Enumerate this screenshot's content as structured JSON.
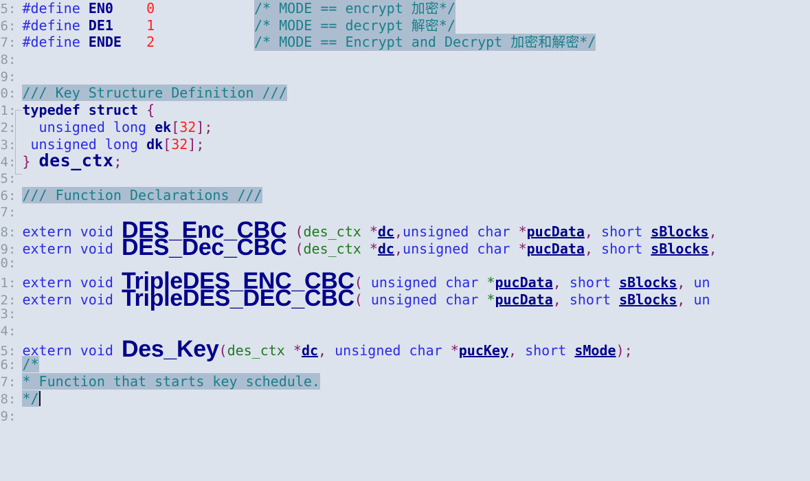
{
  "editor": {
    "background_color": "#dce3ec",
    "comment_highlight_color": "#adbdd0",
    "gutter_color": "#909aa4",
    "keyword_color": "#2a2ae6",
    "identifier_color": "#00008b",
    "number_color": "#ff2020",
    "punctuation_color": "#8b1a6b",
    "comment_color": "#17808a",
    "type_color": "#1f7a1f"
  },
  "lines": [
    {
      "num": "5",
      "tokens": [
        {
          "t": "#define ",
          "c": "kw"
        },
        {
          "t": "EN0",
          "c": "macroname"
        },
        {
          "t": "    ",
          "c": "plain"
        },
        {
          "t": "0",
          "c": "num"
        }
      ],
      "comment": "/* MODE == encrypt 加密*/"
    },
    {
      "num": "6",
      "tokens": [
        {
          "t": "#define ",
          "c": "kw"
        },
        {
          "t": "DE1",
          "c": "macroname"
        },
        {
          "t": "    ",
          "c": "plain"
        },
        {
          "t": "1",
          "c": "num"
        }
      ],
      "comment": "/* MODE == decrypt 解密*/"
    },
    {
      "num": "7",
      "tokens": [
        {
          "t": "#define ",
          "c": "kw"
        },
        {
          "t": "ENDE",
          "c": "macroname"
        },
        {
          "t": "   ",
          "c": "plain"
        },
        {
          "t": "2",
          "c": "num"
        }
      ],
      "comment": "/* MODE == Encrypt and Decrypt 加密和解密*/"
    },
    {
      "num": "8",
      "tokens": [],
      "comment": ""
    },
    {
      "num": "9",
      "tokens": [],
      "comment": ""
    },
    {
      "num": "0",
      "tokens": [],
      "comment_inline": "/// Key Structure Definition  ///"
    },
    {
      "num": "1",
      "tokens": [
        {
          "t": "typedef struct ",
          "c": "kw-b"
        },
        {
          "t": "{",
          "c": "punc"
        }
      ],
      "comment": ""
    },
    {
      "num": "2",
      "tokens": [
        {
          "t": "  unsigned long ",
          "c": "kw"
        },
        {
          "t": "ek",
          "c": "kw-b"
        },
        {
          "t": "[",
          "c": "punc"
        },
        {
          "t": "32",
          "c": "num"
        },
        {
          "t": "]",
          "c": "punc"
        },
        {
          "t": ";",
          "c": "punc"
        }
      ],
      "comment": ""
    },
    {
      "num": "3",
      "tokens": [
        {
          "t": " unsigned long ",
          "c": "kw"
        },
        {
          "t": "dk",
          "c": "kw-b"
        },
        {
          "t": "[",
          "c": "punc"
        },
        {
          "t": "32",
          "c": "num"
        },
        {
          "t": "]",
          "c": "punc"
        },
        {
          "t": ";",
          "c": "punc"
        }
      ],
      "comment": ""
    },
    {
      "num": "4",
      "tokens": [
        {
          "t": "}",
          "c": "punc"
        },
        {
          "t": " ",
          "c": "plain"
        },
        {
          "t": "des_ctx",
          "c": "struct-nm"
        },
        {
          "t": ";",
          "c": "punc"
        }
      ],
      "comment": ""
    },
    {
      "num": "5",
      "tokens": [],
      "comment": ""
    },
    {
      "num": "6",
      "tokens": [],
      "comment_inline": "/// Function Declarations  ///"
    },
    {
      "num": "7",
      "tokens": [],
      "comment": ""
    },
    {
      "num": "8",
      "fn": {
        "prefix": "extern void ",
        "name": "DES_Enc_CBC",
        "args": [
          {
            "t": " (",
            "c": "punc"
          },
          {
            "t": "des_ctx ",
            "c": "type-g"
          },
          {
            "t": "*",
            "c": "punc"
          },
          {
            "t": "dc",
            "c": "param"
          },
          {
            "t": ",",
            "c": "punc"
          },
          {
            "t": "unsigned char ",
            "c": "kw"
          },
          {
            "t": "*",
            "c": "punc"
          },
          {
            "t": "pucData",
            "c": "param"
          },
          {
            "t": ", ",
            "c": "punc"
          },
          {
            "t": "short ",
            "c": "kw"
          },
          {
            "t": "sBlocks",
            "c": "param"
          },
          {
            "t": ",",
            "c": "punc"
          }
        ]
      },
      "comment": ""
    },
    {
      "num": "9",
      "fn": {
        "prefix": "extern void ",
        "name": "DES_Dec_CBC",
        "args": [
          {
            "t": " (",
            "c": "punc"
          },
          {
            "t": "des_ctx ",
            "c": "type-g"
          },
          {
            "t": "*",
            "c": "punc"
          },
          {
            "t": "dc",
            "c": "param"
          },
          {
            "t": ",",
            "c": "punc"
          },
          {
            "t": "unsigned char ",
            "c": "kw"
          },
          {
            "t": "*",
            "c": "punc"
          },
          {
            "t": "pucData",
            "c": "param"
          },
          {
            "t": ", ",
            "c": "punc"
          },
          {
            "t": "short ",
            "c": "kw"
          },
          {
            "t": "sBlocks",
            "c": "param"
          },
          {
            "t": ",",
            "c": "punc"
          }
        ]
      },
      "comment": ""
    },
    {
      "num": "0",
      "tokens": [],
      "comment": ""
    },
    {
      "num": "1",
      "fn": {
        "prefix": "extern void ",
        "name": "TripleDES_ENC_CBC",
        "args": [
          {
            "t": "(",
            "c": "punc"
          },
          {
            "t": " unsigned char ",
            "c": "kw"
          },
          {
            "t": "*",
            "c": "type-g"
          },
          {
            "t": "pucData",
            "c": "param"
          },
          {
            "t": ", ",
            "c": "punc"
          },
          {
            "t": "short ",
            "c": "kw"
          },
          {
            "t": "sBlocks",
            "c": "param"
          },
          {
            "t": ",  ",
            "c": "punc"
          },
          {
            "t": "un",
            "c": "kw"
          }
        ]
      },
      "comment": ""
    },
    {
      "num": "2",
      "fn": {
        "prefix": "extern void ",
        "name": "TripleDES_DEC_CBC",
        "args": [
          {
            "t": "(",
            "c": "punc"
          },
          {
            "t": " unsigned char ",
            "c": "kw"
          },
          {
            "t": "*",
            "c": "type-g"
          },
          {
            "t": "pucData",
            "c": "param"
          },
          {
            "t": ", ",
            "c": "punc"
          },
          {
            "t": "short ",
            "c": "kw"
          },
          {
            "t": "sBlocks",
            "c": "param"
          },
          {
            "t": ",  ",
            "c": "punc"
          },
          {
            "t": "un",
            "c": "kw"
          }
        ]
      },
      "comment": ""
    },
    {
      "num": "3",
      "tokens": [],
      "comment": ""
    },
    {
      "num": "4",
      "tokens": [],
      "comment": ""
    },
    {
      "num": "5",
      "fn": {
        "prefix": "extern void ",
        "name": "Des_Key",
        "args": [
          {
            "t": "(",
            "c": "punc"
          },
          {
            "t": "des_ctx ",
            "c": "type-g"
          },
          {
            "t": "*",
            "c": "punc"
          },
          {
            "t": "dc",
            "c": "param"
          },
          {
            "t": ", ",
            "c": "punc"
          },
          {
            "t": "unsigned char ",
            "c": "kw"
          },
          {
            "t": "*",
            "c": "punc"
          },
          {
            "t": "pucKey",
            "c": "param"
          },
          {
            "t": ", ",
            "c": "punc"
          },
          {
            "t": "short ",
            "c": "kw"
          },
          {
            "t": "sMode",
            "c": "param"
          },
          {
            "t": ")",
            "c": "punc"
          },
          {
            "t": ";",
            "c": "punc"
          }
        ]
      },
      "comment": ""
    },
    {
      "num": "6",
      "tokens": [],
      "comment_inline": "/*"
    },
    {
      "num": "7",
      "tokens": [],
      "comment_inline": " * Function that starts key schedule."
    },
    {
      "num": "8",
      "tokens": [],
      "comment_inline": " */",
      "caret": true
    },
    {
      "num": "9",
      "tokens": [],
      "comment": ""
    }
  ]
}
